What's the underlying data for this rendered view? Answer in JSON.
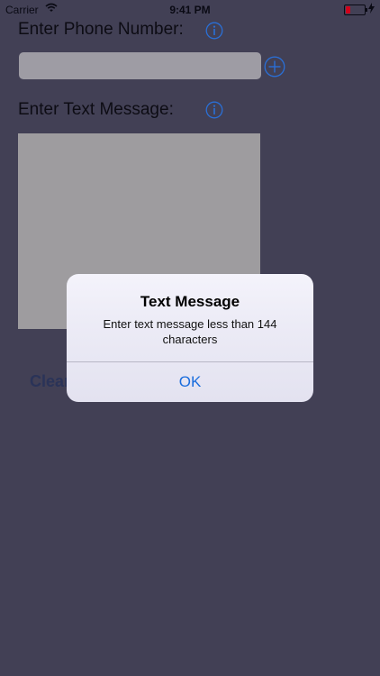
{
  "status_bar": {
    "carrier": "Carrier",
    "time": "9:41 PM"
  },
  "form": {
    "phone_label": "Enter Phone Number:",
    "phone_value": "",
    "message_label": "Enter Text Message:",
    "message_value": "",
    "clear_label": "Clear"
  },
  "alert": {
    "title": "Text Message",
    "message": "Enter text message less than 144 characters",
    "ok_label": "OK"
  },
  "icons": {
    "info": "info-circle-icon",
    "add": "plus-circle-icon",
    "wifi": "wifi-icon",
    "battery": "battery-icon",
    "charging": "bolt-icon"
  },
  "colors": {
    "background": "#424055",
    "field": "#9e9ca4",
    "accent": "#2a6fd6",
    "battery_low": "#d0021b",
    "alert_button": "#1a6ddd"
  }
}
